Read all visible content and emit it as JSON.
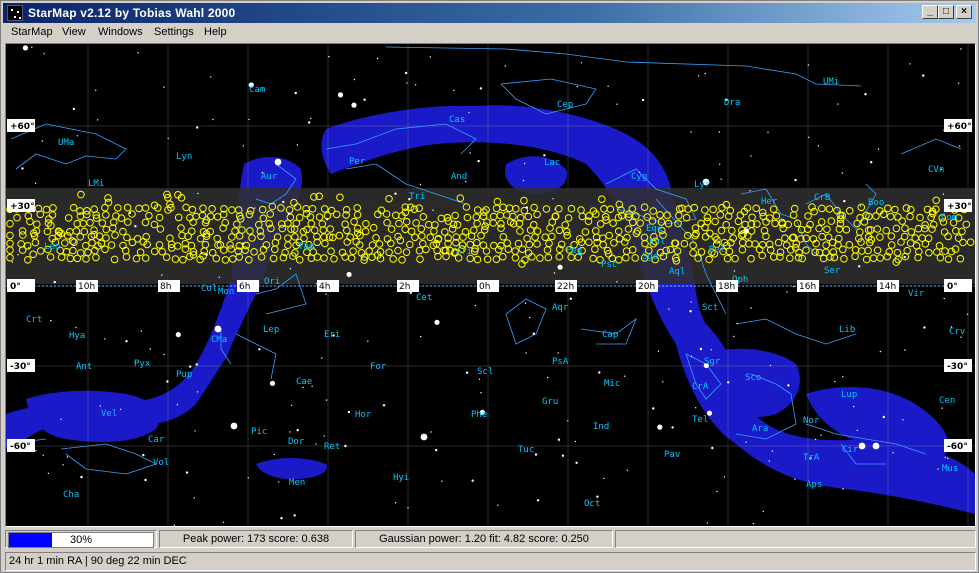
{
  "window": {
    "title": "StarMap v2.12 by Tobias Wahl 2000",
    "controls": {
      "minimize": "_",
      "maximize": "□",
      "close": "×"
    }
  },
  "menu": [
    "StarMap",
    "View",
    "Windows",
    "Settings",
    "Help"
  ],
  "map": {
    "colors": {
      "background": "#000000",
      "milky_way": "#1a1ac8",
      "constellation_name": "#00c8ff",
      "constellation_line": "#3aa0ff",
      "grid": "#a0a0a0",
      "survey_band": "#303030",
      "marker": "#ffff00",
      "star": "#ffffff"
    },
    "dec_labels": [
      "+60°",
      "+30°",
      "0°",
      "-30°",
      "-60°"
    ],
    "ra_labels": [
      "10h",
      "8h",
      "6h",
      "4h",
      "2h",
      "0h",
      "22h",
      "20h",
      "18h",
      "16h",
      "14h"
    ],
    "constellations": [
      "Cam",
      "UMa",
      "Lyn",
      "LMi",
      "Leo",
      "Aur",
      "Per",
      "Cas",
      "Tri",
      "And",
      "Ari",
      "Cep",
      "Lac",
      "Cyg",
      "Lyr",
      "Vul",
      "Her",
      "CrB",
      "Boo",
      "Com",
      "Dra",
      "UMi",
      "CVn",
      "Mon",
      "Ori",
      "Tau",
      "Cet",
      "Peg",
      "Psc",
      "Aqr",
      "Equ",
      "Aql",
      "Sge",
      "Del",
      "Sct",
      "Oph",
      "Ser",
      "Vir",
      "Lib",
      "Crt",
      "Hya",
      "Ant",
      "Pyx",
      "CMa",
      "Lep",
      "Eri",
      "For",
      "Scl",
      "PsA",
      "Cap",
      "Mic",
      "Sgr",
      "CrA",
      "Sco",
      "Lup",
      "Cen",
      "Col",
      "Pup",
      "Cae",
      "Hor",
      "Phe",
      "Gru",
      "Ind",
      "Tel",
      "Ara",
      "Nor",
      "Cir",
      "Vel",
      "Car",
      "Pic",
      "Dor",
      "Ret",
      "Tuc",
      "Pav",
      "TrA",
      "Aps",
      "Mus",
      "Hyi",
      "Men",
      "Oct",
      "Vol",
      "Cha",
      "Crv"
    ],
    "icons": [
      "sky-chart",
      "star",
      "survey-marker"
    ]
  },
  "status": {
    "progress_percent": 30,
    "progress_label": "30%",
    "peak": "Peak power: 173 score: 0.638",
    "gaussian": "Gaussian power: 1.20 fit: 4.82 score: 0.250",
    "coords": "24 hr 1 min RA  |  90 deg 22 min DEC"
  }
}
